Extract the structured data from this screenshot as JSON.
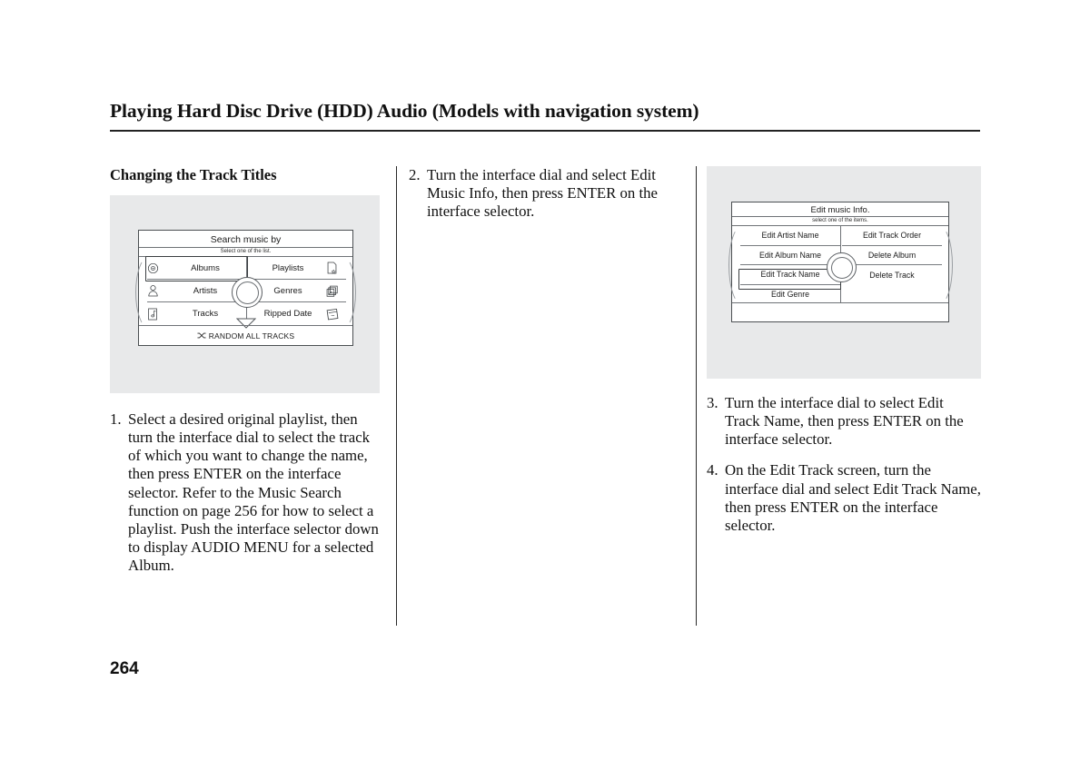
{
  "header": {
    "title": "Playing Hard Disc Drive (HDD) Audio (Models with navigation system)"
  },
  "page_number": "264",
  "left_column": {
    "heading": "Changing the Track Titles",
    "figure": {
      "screen_title": "Search music by",
      "screen_subtitle": "Select one of the list.",
      "items_left": [
        {
          "label": "Albums",
          "icon": "disc-icon",
          "selected": true
        },
        {
          "label": "Artists",
          "icon": "person-icon",
          "selected": false
        },
        {
          "label": "Tracks",
          "icon": "music-note-page-icon",
          "selected": false
        }
      ],
      "items_right": [
        {
          "label": "Playlists",
          "icon": "playlist-star-icon"
        },
        {
          "label": "Genres",
          "icon": "genre-stack-icon"
        },
        {
          "label": "Ripped Date",
          "icon": "calendar-note-icon"
        }
      ],
      "bottom_bar": "RANDOM ALL TRACKS",
      "bottom_bar_icon": "shuffle-icon",
      "dial": "interface-dial"
    },
    "steps": [
      {
        "number": "1.",
        "text": "Select a desired original playlist, then turn the interface dial to select the track of which you want to change the name, then press ENTER on the interface selector. Refer to the Music Search function on page 256 for how to select a playlist. Push the interface selector down to display AUDIO MENU for a selected Album."
      }
    ]
  },
  "middle_column": {
    "steps": [
      {
        "number": "2.",
        "text": "Turn the interface dial and select Edit Music Info, then press ENTER on the interface selector."
      }
    ]
  },
  "right_column": {
    "figure": {
      "screen_title": "Edit music Info.",
      "screen_subtitle": "select one of the items.",
      "items_left": [
        {
          "label": "Edit Artist Name",
          "selected": false
        },
        {
          "label": "Edit Album Name",
          "selected": false
        },
        {
          "label": "Edit Track Name",
          "selected": true
        },
        {
          "label": "Edit Genre",
          "selected": false
        }
      ],
      "items_right": [
        {
          "label": "Edit Track Order"
        },
        {
          "label": "Delete Album"
        },
        {
          "label": "Delete Track"
        }
      ],
      "dial": "interface-dial"
    },
    "steps": [
      {
        "number": "3.",
        "text": "Turn the interface dial to select Edit Track Name, then press ENTER on the interface selector."
      },
      {
        "number": "4.",
        "text": "On the Edit Track screen, turn the interface dial and select Edit Track Name, then press ENTER on the interface selector."
      }
    ]
  },
  "colors": {
    "figure_plate": "#e8e9ea",
    "rule": "#232323",
    "screen_border": "#4b4f52",
    "text": "#111111"
  }
}
